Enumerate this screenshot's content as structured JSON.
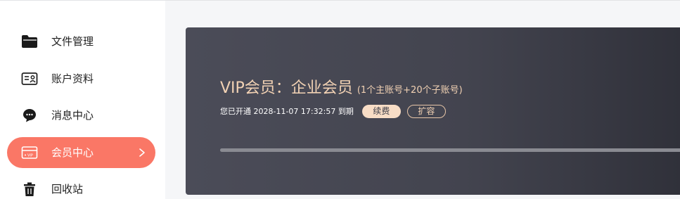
{
  "sidebar": {
    "items": [
      {
        "label": "文件管理",
        "icon": "folder-icon",
        "active": false
      },
      {
        "label": "账户资料",
        "icon": "id-card-icon",
        "active": false
      },
      {
        "label": "消息中心",
        "icon": "message-icon",
        "active": false
      },
      {
        "label": "会员中心",
        "icon": "vip-card-icon",
        "active": true
      },
      {
        "label": "回收站",
        "icon": "trash-icon",
        "active": false
      }
    ]
  },
  "vip": {
    "title": "VIP会员：企业会员",
    "subtitle": "(1个主账号+20个子账号)",
    "status_text": "您已开通 2028-11-07 17:32:57 到期",
    "renew_label": "续费",
    "expand_label": "扩容",
    "progress": 1.0
  },
  "colors": {
    "accent": "#fa7766",
    "gold": "#f2d2b4",
    "card_bg": "#45464f"
  }
}
